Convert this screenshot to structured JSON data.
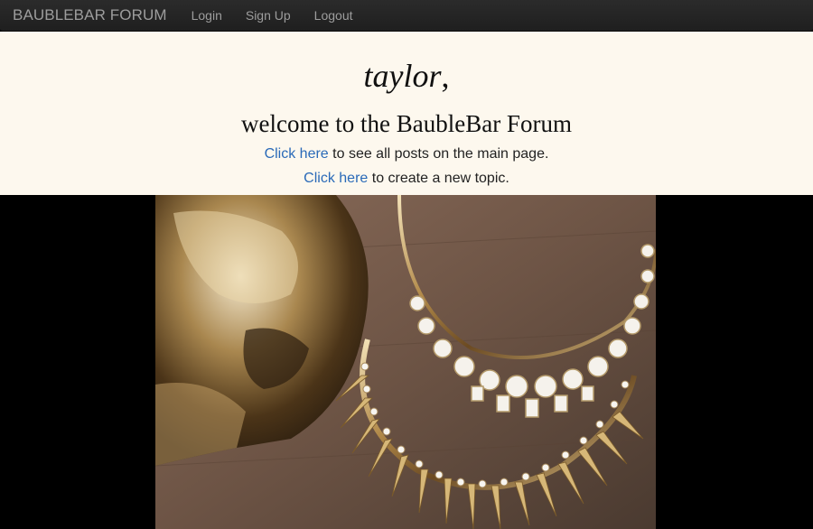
{
  "navbar": {
    "brand": "BAUBLEBAR FORUM",
    "links": [
      "Login",
      "Sign Up",
      "Logout"
    ]
  },
  "welcome": {
    "username": "taylor",
    "username_suffix": ",",
    "title": "welcome to the BaubleBar Forum",
    "line1": {
      "link": "Click here",
      "text": " to see all posts on the main page."
    },
    "line2": {
      "link": "Click here",
      "text": " to create a new topic."
    }
  },
  "colors": {
    "navbar_bg": "#222222",
    "nav_text": "#9d9d9d",
    "welcome_bg": "#fdf8ee",
    "link": "#2a6ab8",
    "page_bg": "#000000"
  },
  "hero_image": {
    "icon": "jewelry-photo"
  }
}
